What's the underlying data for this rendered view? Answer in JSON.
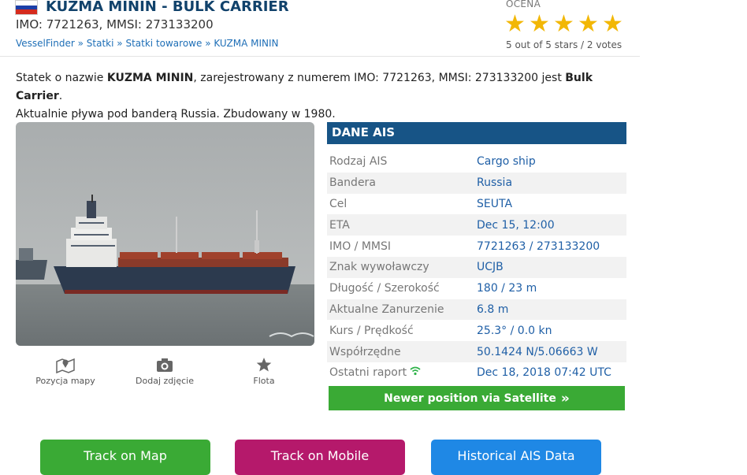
{
  "header": {
    "title": "KUZMA MININ - BULK CARRIER",
    "identifiers": "IMO: 7721263, MMSI: 273133200",
    "breadcrumbs": [
      "VesselFinder",
      "Statki",
      "Statki towarowe",
      "KUZMA MININ"
    ],
    "breadcrumb_separator": "»"
  },
  "rating": {
    "label": "OCENA",
    "stars": 5,
    "max_stars": 5,
    "text": "5 out of 5 stars / 2 votes"
  },
  "description": {
    "p1": "Statek o nazwie ",
    "name": "KUZMA MININ",
    "p2": ", zarejestrowany z numerem IMO: 7721263, MMSI: 273133200 jest ",
    "type": "Bulk Carrier",
    "p3": ".",
    "line2": "Aktualnie pływa pod banderą Russia. Zbudowany w 1980."
  },
  "photo_actions": [
    {
      "label": "Pozycja mapy",
      "icon": "map-pin-icon"
    },
    {
      "label": "Dodaj zdjęcie",
      "icon": "camera-icon"
    },
    {
      "label": "Flota",
      "icon": "star-icon"
    }
  ],
  "ais": {
    "title": "DANE AIS",
    "rows": [
      {
        "label": "Rodzaj AIS",
        "value": "Cargo ship"
      },
      {
        "label": "Bandera",
        "value": "Russia"
      },
      {
        "label": "Cel",
        "value": "SEUTA"
      },
      {
        "label": "ETA",
        "value": "Dec 15, 12:00"
      },
      {
        "label": "IMO / MMSI",
        "value": "7721263 / 273133200"
      },
      {
        "label": "Znak wywoławczy",
        "value": "UCJB"
      },
      {
        "label": "Długość / Szerokość",
        "value": "180 / 23 m"
      },
      {
        "label": "Aktualne Zanurzenie",
        "value": "6.8 m"
      },
      {
        "label": "Kurs / Prędkość",
        "value": "25.3° / 0.0 kn"
      },
      {
        "label": "Współrzędne",
        "value": "50.1424 N/5.06663 W"
      },
      {
        "label": "Ostatni raport",
        "value": "Dec 18, 2018 07:42 UTC"
      }
    ],
    "satellite_button": "Newer position via Satellite",
    "satellite_icon": "»"
  },
  "buttons": {
    "track_map": "Track on Map",
    "track_mobile": "Track on Mobile",
    "historical": "Historical AIS Data"
  },
  "colors": {
    "title": "#11426b",
    "ais_header": "#175486",
    "link": "#1f6fb7",
    "star": "#f2b705",
    "green": "#3aaa35",
    "magenta": "#b5196b",
    "blue": "#1f88e5"
  }
}
